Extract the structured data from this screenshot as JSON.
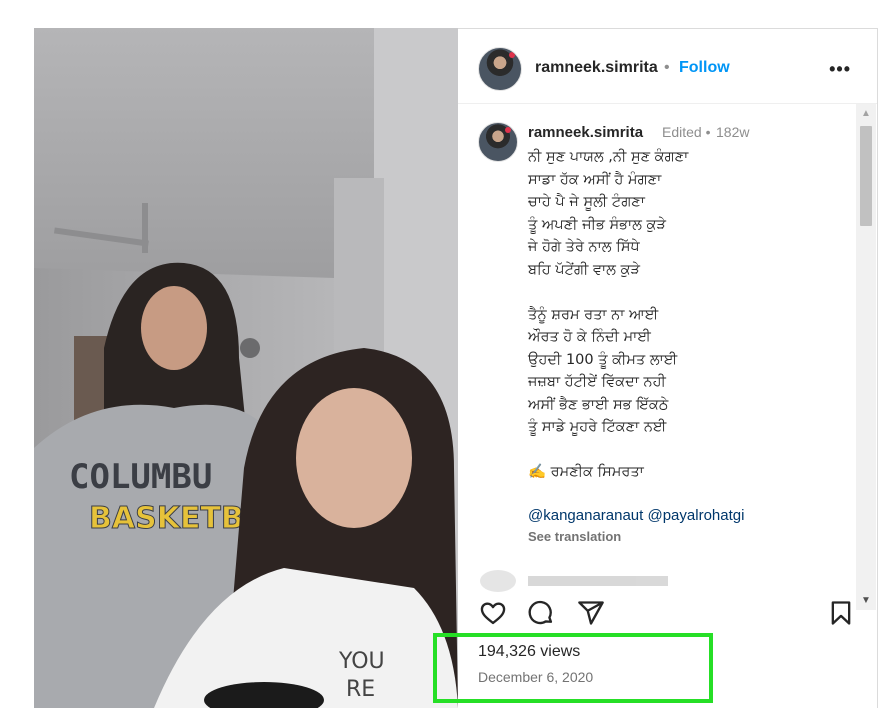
{
  "post": {
    "username": "ramneek.simrita",
    "follow_dot": "•",
    "follow_label": "Follow",
    "more_label": "•••"
  },
  "caption": {
    "username": "ramneek.simrita",
    "edited_label": "Edited •",
    "age": "182w",
    "text": "ਨੀ ਸੁਣ ਪਾਯਲ ,ਨੀ ਸੁਣ ਕੰਗਣਾ\nਸਾਡਾ ਹੱਕ ਅਸੀਂ ਹੈ ਮੰਗਣਾ\nਚਾਹੇ ਪੈ ਜੇ ਸੂਲੀ ਟੰਗਣਾ\nਤੂੰ ਅਪਣੀ ਜੀਭ ਸੰਭਾਲ ਕੁੜੇ\nਜੇ ਹੋਗੇ ਤੇਰੇ ਨਾਲ ਸਿੱਧੇ\nਬਹਿ ਪੱਟੇਂਗੀ ਵਾਲ ਕੁੜੇ\n\nਤੈਨੂੰ ਸ਼ਰਮ ਰਤਾ ਨਾ ਆਈ\nਔਰਤ ਹੋ ਕੇ ਨਿੰਦੀ ਮਾਈ\nਉਹਦੀ 100 ਤੂੰ ਕੀਮਤ ਲਾਈ\nਜਜ਼ਬਾ ਹੱਟੀਏਂ ਵਿੱਕਦਾ ਨਹੀ\nਅਸੀਂ ਭੈਣ ਭਾਈ ਸਭ ਇੱਕਠੇ\nਤੂੰ ਸਾਡੇ ਮੂਹਰੇ ਟਿੱਕਣਾ ਨਈ\n\n✍️ ਰਮਣੀਕ ਸਿਮਰਤਾ",
    "mention_1": "@kanganaranaut",
    "mention_2": "@payalrohatgi",
    "see_translation": "See translation"
  },
  "stats": {
    "views": "194,326 views",
    "date": "December 6, 2020"
  },
  "media": {
    "sweatshirt_line_1": "COLUMBU",
    "sweatshirt_line_2": "BASKETBALL",
    "shirt_text_1": "YOU",
    "shirt_text_2": "RE"
  },
  "colors": {
    "accent_link": "#0095f6",
    "highlight": "#26df26",
    "mention": "#00376b"
  },
  "icons": {
    "like": "heart-icon",
    "comment": "comment-icon",
    "share": "share-icon",
    "save": "bookmark-icon"
  }
}
